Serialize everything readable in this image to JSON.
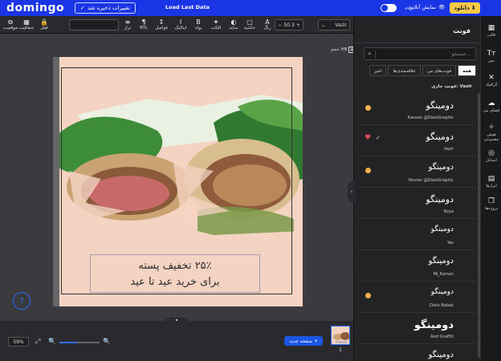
{
  "topbar": {
    "logo": "domingo",
    "saved": "تغییرات ذخیره شد",
    "last_data": "Load Last Data",
    "toggle_label": "عادی",
    "preview": "نمایش آنلاین",
    "download": "دانلود"
  },
  "toolbar": {
    "font": "Vazir",
    "font_size": "50.3",
    "tools": [
      {
        "icon": "link-icon",
        "label": "موقعیت",
        "glyph": "⧉"
      },
      {
        "icon": "opacity-icon",
        "label": "شفافیت",
        "glyph": "▦"
      },
      {
        "icon": "lock-icon",
        "label": "قفل",
        "glyph": "🔒"
      },
      {
        "icon": "align-icon",
        "label": "تراز",
        "glyph": "≡"
      },
      {
        "icon": "rtl-icon",
        "label": "RTL",
        "glyph": "¶"
      },
      {
        "icon": "spacing-icon",
        "label": "فواصل",
        "glyph": "↕"
      },
      {
        "icon": "italic-icon",
        "label": "ایتالیک",
        "glyph": "I"
      },
      {
        "icon": "bold-icon",
        "label": "بولد",
        "glyph": "B"
      },
      {
        "icon": "effect-icon",
        "label": "افکت",
        "glyph": "✦"
      },
      {
        "icon": "shadow-icon",
        "label": "سایه",
        "glyph": "◐"
      },
      {
        "icon": "border-icon",
        "label": "حاشیه",
        "glyph": "▢"
      },
      {
        "icon": "color-icon",
        "label": "رنگ",
        "glyph": "A"
      }
    ]
  },
  "canvas": {
    "size_label": "حجم HB",
    "promo_line1": "۲۵٪ تخفیف پسته",
    "promo_line2": "برای خرید عید تا عید"
  },
  "bottom": {
    "zoom": "59%",
    "zoom_fraction": 0.44,
    "new_page": "صفحه جدید +",
    "page_number": "1"
  },
  "panel": {
    "title": "فونت",
    "search_placeholder": "جستجو...",
    "tabs": [
      "همه",
      "فونت‌های من",
      "علاقه‌مندی‌ها",
      "اخیر"
    ],
    "current_font": "فونت جاری: Vazir",
    "fonts": [
      {
        "sample": "دومینگو",
        "name": "Kavoon @DialoGraphic",
        "mark": "dot"
      },
      {
        "sample": "دومینگو",
        "name": "Vazir",
        "mark": "heart"
      },
      {
        "sample": "دومینگو",
        "name": "Hosner @DialoGraphic",
        "mark": "dot"
      },
      {
        "sample": "دومینگو",
        "name": "Roya",
        "mark": ""
      },
      {
        "sample": "دومینگو",
        "name": "Yas",
        "mark": ""
      },
      {
        "sample": "دومینگو",
        "name": "Mj_Kaman",
        "mark": ""
      },
      {
        "sample": "دومینگو",
        "name": "Dialo Babak",
        "mark": "dot"
      },
      {
        "sample": "دومینگو",
        "name": "Aref Graffiti",
        "mark": ""
      },
      {
        "sample": "دومینگو",
        "name": "",
        "mark": ""
      }
    ]
  },
  "rail": [
    {
      "icon": "template-icon",
      "label": "قالب",
      "glyph": "▦"
    },
    {
      "icon": "text-icon",
      "label": "متن",
      "glyph": "Tт"
    },
    {
      "icon": "graphics-icon",
      "label": "گرافیک",
      "glyph": "✕"
    },
    {
      "icon": "upload-icon",
      "label": "فضای من",
      "glyph": "☁"
    },
    {
      "icon": "ai-icon",
      "label": "هوش مصنوعی",
      "glyph": "✧"
    },
    {
      "icon": "style-icon",
      "label": "استایل",
      "glyph": "◎"
    },
    {
      "icon": "tools-icon",
      "label": "ابزارها",
      "glyph": "▤"
    },
    {
      "icon": "projects-icon",
      "label": "پروژه‌ها",
      "glyph": "❐"
    }
  ],
  "colors": {
    "brand_blue": "#1a35e6",
    "download_yellow": "#f7c948",
    "artboard_bg": "#f5d3c3"
  }
}
